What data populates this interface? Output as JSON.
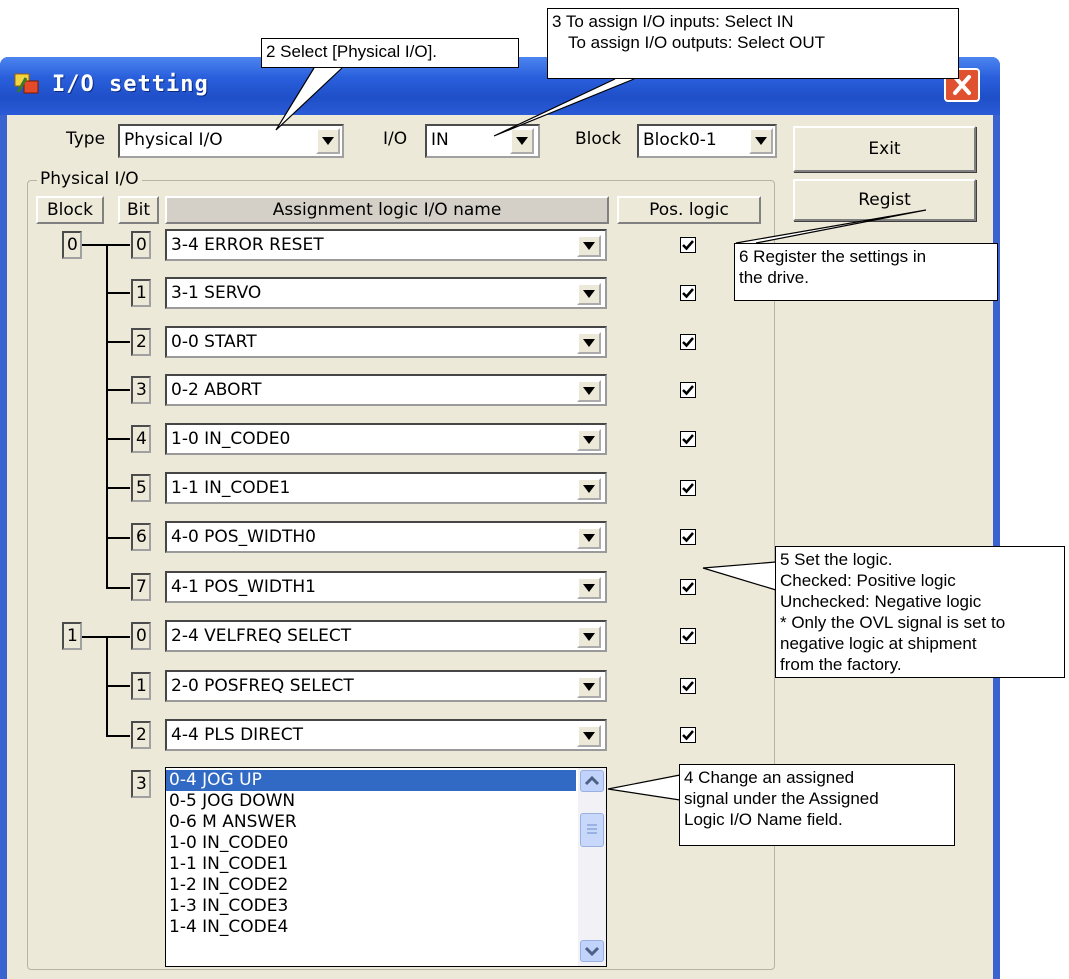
{
  "window": {
    "title": "I/O setting"
  },
  "top": {
    "type_label": "Type",
    "type_value": "Physical I/O",
    "io_label": "I/O",
    "io_value": "IN",
    "block_label": "Block",
    "block_value": "Block0-1",
    "exit_label": "Exit",
    "regist_label": "Regist"
  },
  "group": {
    "title": "Physical I/O",
    "headers": {
      "block": "Block",
      "bit": "Bit",
      "assign": "Assignment logic I/O name",
      "pos": "Pos. logic"
    }
  },
  "rows": [
    {
      "block": "0",
      "bit": "0",
      "name": "3-4 ERROR RESET",
      "checked": true
    },
    {
      "block": "",
      "bit": "1",
      "name": "3-1 SERVO",
      "checked": true
    },
    {
      "block": "",
      "bit": "2",
      "name": "0-0 START",
      "checked": true
    },
    {
      "block": "",
      "bit": "3",
      "name": "0-2 ABORT",
      "checked": true
    },
    {
      "block": "",
      "bit": "4",
      "name": "1-0 IN_CODE0",
      "checked": true
    },
    {
      "block": "",
      "bit": "5",
      "name": "1-1 IN_CODE1",
      "checked": true
    },
    {
      "block": "",
      "bit": "6",
      "name": "4-0 POS_WIDTH0",
      "checked": true
    },
    {
      "block": "",
      "bit": "7",
      "name": "4-1 POS_WIDTH1",
      "checked": true
    },
    {
      "block": "1",
      "bit": "0",
      "name": "2-4 VELFREQ SELECT",
      "checked": true
    },
    {
      "block": "",
      "bit": "1",
      "name": "2-0 POSFREQ SELECT",
      "checked": true
    },
    {
      "block": "",
      "bit": "2",
      "name": "4-4 PLS DIRECT",
      "checked": true
    },
    {
      "block": "",
      "bit": "3",
      "name": "0-4 JOG UP",
      "checked": true
    }
  ],
  "dropdown": {
    "items": [
      "0-4 JOG UP",
      "0-5 JOG DOWN",
      "0-6 M ANSWER",
      "1-0 IN_CODE0",
      "1-1 IN_CODE1",
      "1-2 IN_CODE2",
      "1-3 IN_CODE3",
      "1-4 IN_CODE4"
    ],
    "selected": "0-4 JOG UP"
  },
  "callouts": {
    "c2": "2 Select [Physical I/O].",
    "c3_line1": "3  To assign I/O inputs: Select IN",
    "c3_line2": "To assign I/O outputs: Select OUT",
    "c6_line1": "6 Register the settings in",
    "c6_line2": "the drive.",
    "c5_lines": [
      "5 Set the logic.",
      "Checked: Positive logic",
      "Unchecked: Negative logic",
      "* Only the OVL signal is set to",
      "negative logic at shipment",
      "from the factory."
    ],
    "c4_lines": [
      "4 Change an assigned",
      "signal under the Assigned",
      "Logic I/O Name field."
    ]
  },
  "colors": {
    "titlebar": "#2a5fdc",
    "close": "#e0512f",
    "selection": "#316ac5",
    "face": "#ece9d8"
  }
}
